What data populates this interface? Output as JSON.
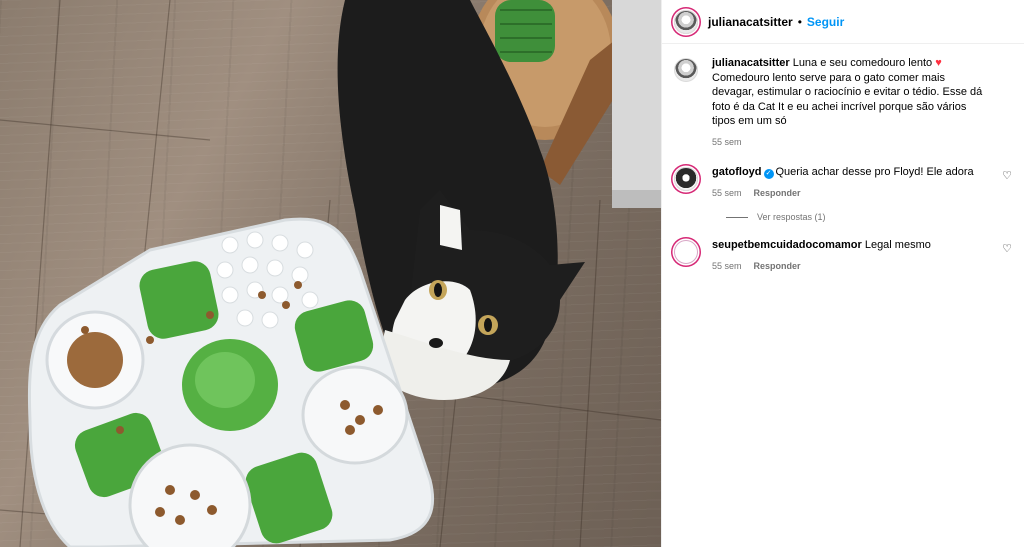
{
  "post": {
    "author": "julianacatsitter",
    "follow_label": "Seguir",
    "caption_user": "julianacatsitter",
    "caption_text_a": " Luna e seu comedouro lento ",
    "caption_heart": "♥",
    "caption_text_b": " Comedouro lento serve para o gato comer mais devagar, estimular o raciocínio e evitar o tédio. Esse dá foto é da Cat It e eu achei incrível porque são vários tipos em um só",
    "caption_time": "55 sem"
  },
  "comments": [
    {
      "user": "gatofloyd",
      "verified": true,
      "text": "Queria achar desse pro Floyd! Ele adora",
      "time": "55 sem",
      "reply_label": "Responder",
      "view_replies": "Ver respostas (1)"
    },
    {
      "user": "seupetbemcuidadocomamor",
      "text": "Legal mesmo",
      "time": "55 sem",
      "reply_label": "Responder"
    }
  ],
  "icons": {
    "like": "heart-outline-icon",
    "caption_heart": "red-heart-emoji",
    "verified": "verified-badge-icon"
  },
  "colors": {
    "follow": "#0095f6",
    "meta": "#737373",
    "heart": "#ff3040"
  }
}
